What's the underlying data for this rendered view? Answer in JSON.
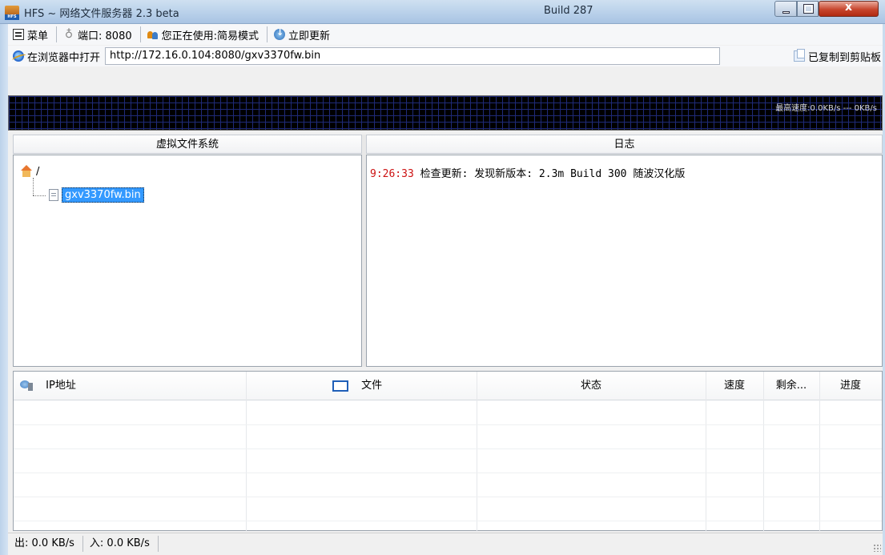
{
  "window": {
    "title": "HFS ~ 网络文件服务器 2.3 beta",
    "build": "Build 287",
    "close_glyph": "x"
  },
  "toolbar": {
    "menu_label": "菜单",
    "port_label": "端口: 8080",
    "mode_label": "您正在使用:简易模式",
    "update_label": "立即更新"
  },
  "address": {
    "open_label": "在浏览器中打开",
    "url": "http://172.16.0.104:8080/gxv3370fw.bin",
    "copied_label": "已复制到剪贴板"
  },
  "graph": {
    "speed_label": "最高速度:0.0KB/s --- 0KB/s"
  },
  "vfs": {
    "header": "虚拟文件系统",
    "root_label": "/",
    "file_label": "gxv3370fw.bin"
  },
  "log": {
    "header": "日志",
    "entries": [
      {
        "time": "9:26:33",
        "message": "检查更新: 发现新版本: 2.3m Build 300 随波汉化版"
      }
    ]
  },
  "connections": {
    "columns": [
      "IP地址",
      "文件",
      "状态",
      "速度",
      "剩余...",
      "进度"
    ]
  },
  "status": {
    "out": "出: 0.0 KB/s",
    "in": "入: 0.0 KB/s"
  },
  "colors": {
    "log_time": "#cc1111",
    "selection": "#3399ff",
    "graph_bg": "#000000",
    "graph_grid": "#1f2a78"
  }
}
